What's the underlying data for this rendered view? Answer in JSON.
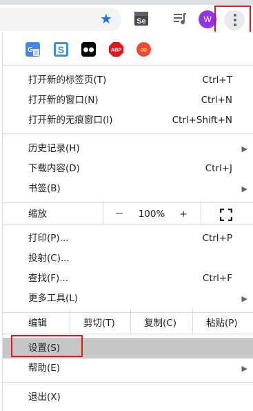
{
  "toolbar": {
    "avatar_letter": "W",
    "icons": [
      "bookmark-star-icon",
      "selenium-ide-icon",
      "media-control-icon",
      "profile-avatar",
      "more-menu-icon"
    ],
    "star_color": "#1a73e8",
    "avatar_color": "#9334e6"
  },
  "extensions": [
    {
      "name": "google-translate-icon",
      "color": "#4285f4"
    },
    {
      "name": "s-extension-icon",
      "color": "#3d8fd6"
    },
    {
      "name": "glasses-extension-icon",
      "color": "#000000"
    },
    {
      "name": "adblock-plus-icon",
      "color": "#e3141c",
      "text": "ABP"
    },
    {
      "name": "infinity-extension-icon",
      "color": "#f04a36"
    }
  ],
  "menu": {
    "new_tab": {
      "label": "打开新的标签页(T)",
      "shortcut": "Ctrl+T"
    },
    "new_window": {
      "label": "打开新的窗口(N)",
      "shortcut": "Ctrl+N"
    },
    "new_incognito": {
      "label": "打开新的无痕窗口(I)",
      "shortcut": "Ctrl+Shift+N"
    },
    "history": {
      "label": "历史记录(H)"
    },
    "downloads": {
      "label": "下载内容(D)",
      "shortcut": "Ctrl+J"
    },
    "bookmarks": {
      "label": "书签(B)"
    },
    "zoom": {
      "label": "缩放",
      "minus": "－",
      "value": "100%",
      "plus": "+"
    },
    "print": {
      "label": "打印(P)...",
      "shortcut": "Ctrl+P"
    },
    "cast": {
      "label": "投射(C)..."
    },
    "find": {
      "label": "查找(F)...",
      "shortcut": "Ctrl+F"
    },
    "more_tools": {
      "label": "更多工具(L)"
    },
    "edit": {
      "label": "编辑",
      "cut": "剪切(T)",
      "copy": "复制(C)",
      "paste": "粘贴(P)"
    },
    "settings": {
      "label": "设置(S)"
    },
    "help": {
      "label": "帮助(E)"
    },
    "exit": {
      "label": "退出(X)"
    }
  },
  "highlight_color": "#e0161d"
}
